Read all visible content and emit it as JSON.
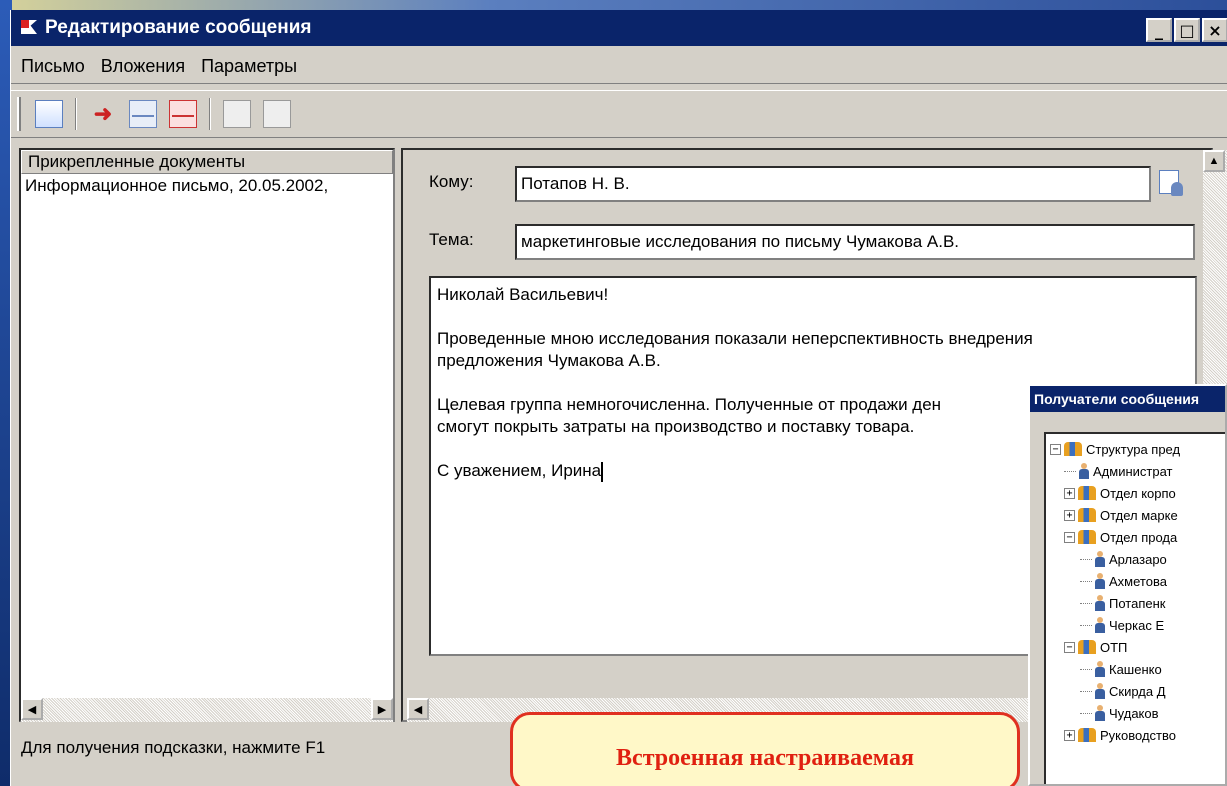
{
  "window": {
    "title": "Редактирование сообщения",
    "btn_min": "_",
    "btn_max": "□",
    "btn_close": "×"
  },
  "menu": [
    {
      "label": "Письмо"
    },
    {
      "label": "Вложения"
    },
    {
      "label": "Параметры"
    }
  ],
  "toolbar": {
    "icons": [
      "letter-icon",
      "forward-icon",
      "send-receive-icon",
      "envelope-red-icon",
      "reply-icon",
      "reply-all-icon"
    ]
  },
  "attachments": {
    "header": "Прикрепленные документы",
    "items": [
      "Информационное письмо, 20.05.2002,"
    ]
  },
  "message": {
    "to_label": "Кому:",
    "to_value": "Потапов Н. В.",
    "subject_label": "Тема:",
    "subject_value": "маркетинговые исследования по письму Чумакова А.В.",
    "body_lines": [
      "Николай Васильевич!",
      "",
      "Проведенные мною исследования показали неперспективность внедрения",
      "предложения Чумакова А.В.",
      "",
      "Целевая группа немногочисленна. Полученные от продажи ден",
      "смогут покрыть затраты на производство и поставку товара.",
      "",
      "С уважением, Ирина"
    ]
  },
  "status": {
    "text": "Для получения подсказки, нажмите F1"
  },
  "recipients_dialog": {
    "title": "Получатели сообщения",
    "tree": [
      {
        "label": "Структура пред",
        "type": "group",
        "toggle": "⊟",
        "level": 0
      },
      {
        "label": "Администрат",
        "type": "person",
        "level": 1
      },
      {
        "label": "Отдел корпо",
        "type": "group",
        "toggle": "⊞",
        "level": 1
      },
      {
        "label": "Отдел марке",
        "type": "group",
        "toggle": "⊞",
        "level": 1
      },
      {
        "label": "Отдел прода",
        "type": "group",
        "toggle": "⊟",
        "level": 1
      },
      {
        "label": "Арлазаро",
        "type": "person",
        "level": 2
      },
      {
        "label": "Ахметова",
        "type": "person",
        "level": 2
      },
      {
        "label": "Потапенк",
        "type": "person",
        "level": 2
      },
      {
        "label": "Черкас Е",
        "type": "person",
        "level": 2
      },
      {
        "label": "ОТП",
        "type": "group",
        "toggle": "⊟",
        "level": 1
      },
      {
        "label": "Кашенко",
        "type": "person",
        "level": 2
      },
      {
        "label": "Скирда Д",
        "type": "person",
        "level": 2
      },
      {
        "label": "Чудаков",
        "type": "person",
        "level": 2
      },
      {
        "label": "Руководство",
        "type": "group",
        "toggle": "⊞",
        "level": 1
      }
    ]
  },
  "callout": {
    "text": "Встроенная настраиваемая"
  },
  "colors": {
    "titlebar": "#0a246a",
    "callout_border": "#e03020",
    "callout_text": "#e02010"
  }
}
